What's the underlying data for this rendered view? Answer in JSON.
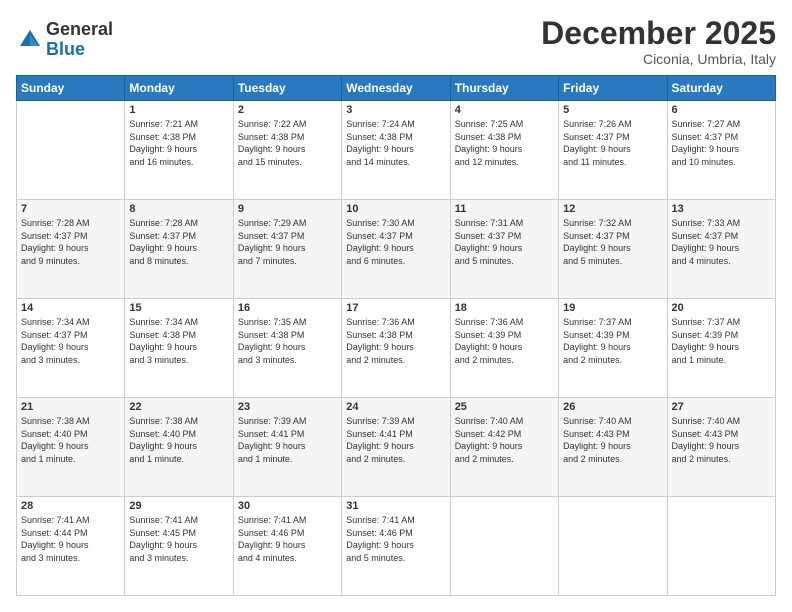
{
  "logo": {
    "general": "General",
    "blue": "Blue"
  },
  "header": {
    "month": "December 2025",
    "location": "Ciconia, Umbria, Italy"
  },
  "weekdays": [
    "Sunday",
    "Monday",
    "Tuesday",
    "Wednesday",
    "Thursday",
    "Friday",
    "Saturday"
  ],
  "weeks": [
    [
      {
        "day": "",
        "info": ""
      },
      {
        "day": "1",
        "info": "Sunrise: 7:21 AM\nSunset: 4:38 PM\nDaylight: 9 hours\nand 16 minutes."
      },
      {
        "day": "2",
        "info": "Sunrise: 7:22 AM\nSunset: 4:38 PM\nDaylight: 9 hours\nand 15 minutes."
      },
      {
        "day": "3",
        "info": "Sunrise: 7:24 AM\nSunset: 4:38 PM\nDaylight: 9 hours\nand 14 minutes."
      },
      {
        "day": "4",
        "info": "Sunrise: 7:25 AM\nSunset: 4:38 PM\nDaylight: 9 hours\nand 12 minutes."
      },
      {
        "day": "5",
        "info": "Sunrise: 7:26 AM\nSunset: 4:37 PM\nDaylight: 9 hours\nand 11 minutes."
      },
      {
        "day": "6",
        "info": "Sunrise: 7:27 AM\nSunset: 4:37 PM\nDaylight: 9 hours\nand 10 minutes."
      }
    ],
    [
      {
        "day": "7",
        "info": "Sunrise: 7:28 AM\nSunset: 4:37 PM\nDaylight: 9 hours\nand 9 minutes."
      },
      {
        "day": "8",
        "info": "Sunrise: 7:28 AM\nSunset: 4:37 PM\nDaylight: 9 hours\nand 8 minutes."
      },
      {
        "day": "9",
        "info": "Sunrise: 7:29 AM\nSunset: 4:37 PM\nDaylight: 9 hours\nand 7 minutes."
      },
      {
        "day": "10",
        "info": "Sunrise: 7:30 AM\nSunset: 4:37 PM\nDaylight: 9 hours\nand 6 minutes."
      },
      {
        "day": "11",
        "info": "Sunrise: 7:31 AM\nSunset: 4:37 PM\nDaylight: 9 hours\nand 5 minutes."
      },
      {
        "day": "12",
        "info": "Sunrise: 7:32 AM\nSunset: 4:37 PM\nDaylight: 9 hours\nand 5 minutes."
      },
      {
        "day": "13",
        "info": "Sunrise: 7:33 AM\nSunset: 4:37 PM\nDaylight: 9 hours\nand 4 minutes."
      }
    ],
    [
      {
        "day": "14",
        "info": "Sunrise: 7:34 AM\nSunset: 4:37 PM\nDaylight: 9 hours\nand 3 minutes."
      },
      {
        "day": "15",
        "info": "Sunrise: 7:34 AM\nSunset: 4:38 PM\nDaylight: 9 hours\nand 3 minutes."
      },
      {
        "day": "16",
        "info": "Sunrise: 7:35 AM\nSunset: 4:38 PM\nDaylight: 9 hours\nand 3 minutes."
      },
      {
        "day": "17",
        "info": "Sunrise: 7:36 AM\nSunset: 4:38 PM\nDaylight: 9 hours\nand 2 minutes."
      },
      {
        "day": "18",
        "info": "Sunrise: 7:36 AM\nSunset: 4:39 PM\nDaylight: 9 hours\nand 2 minutes."
      },
      {
        "day": "19",
        "info": "Sunrise: 7:37 AM\nSunset: 4:39 PM\nDaylight: 9 hours\nand 2 minutes."
      },
      {
        "day": "20",
        "info": "Sunrise: 7:37 AM\nSunset: 4:39 PM\nDaylight: 9 hours\nand 1 minute."
      }
    ],
    [
      {
        "day": "21",
        "info": "Sunrise: 7:38 AM\nSunset: 4:40 PM\nDaylight: 9 hours\nand 1 minute."
      },
      {
        "day": "22",
        "info": "Sunrise: 7:38 AM\nSunset: 4:40 PM\nDaylight: 9 hours\nand 1 minute."
      },
      {
        "day": "23",
        "info": "Sunrise: 7:39 AM\nSunset: 4:41 PM\nDaylight: 9 hours\nand 1 minute."
      },
      {
        "day": "24",
        "info": "Sunrise: 7:39 AM\nSunset: 4:41 PM\nDaylight: 9 hours\nand 2 minutes."
      },
      {
        "day": "25",
        "info": "Sunrise: 7:40 AM\nSunset: 4:42 PM\nDaylight: 9 hours\nand 2 minutes."
      },
      {
        "day": "26",
        "info": "Sunrise: 7:40 AM\nSunset: 4:43 PM\nDaylight: 9 hours\nand 2 minutes."
      },
      {
        "day": "27",
        "info": "Sunrise: 7:40 AM\nSunset: 4:43 PM\nDaylight: 9 hours\nand 2 minutes."
      }
    ],
    [
      {
        "day": "28",
        "info": "Sunrise: 7:41 AM\nSunset: 4:44 PM\nDaylight: 9 hours\nand 3 minutes."
      },
      {
        "day": "29",
        "info": "Sunrise: 7:41 AM\nSunset: 4:45 PM\nDaylight: 9 hours\nand 3 minutes."
      },
      {
        "day": "30",
        "info": "Sunrise: 7:41 AM\nSunset: 4:46 PM\nDaylight: 9 hours\nand 4 minutes."
      },
      {
        "day": "31",
        "info": "Sunrise: 7:41 AM\nSunset: 4:46 PM\nDaylight: 9 hours\nand 5 minutes."
      },
      {
        "day": "",
        "info": ""
      },
      {
        "day": "",
        "info": ""
      },
      {
        "day": "",
        "info": ""
      }
    ]
  ]
}
